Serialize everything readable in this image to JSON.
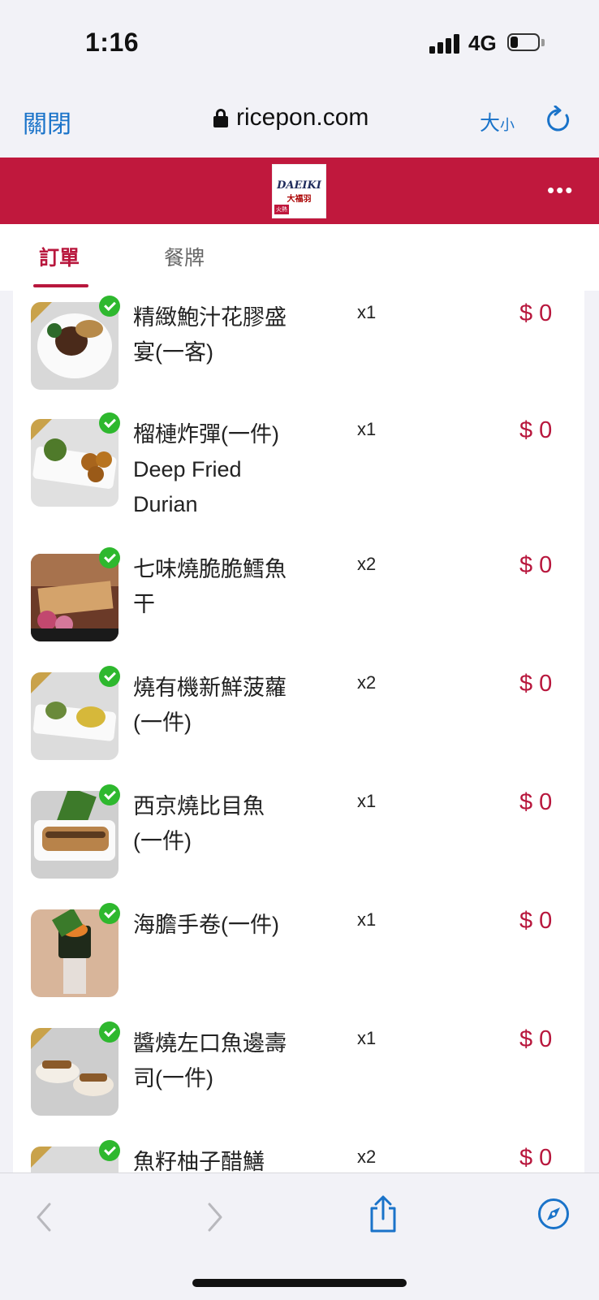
{
  "status_bar": {
    "time": "1:16",
    "network": "4G"
  },
  "browser": {
    "close_label": "關閉",
    "url": "ricepon.com",
    "text_size_big": "大",
    "text_size_small": "小"
  },
  "app": {
    "logo_text": "DAEIKI",
    "logo_subtitle": "大福羽",
    "logo_tag": "火熱",
    "brand_color": "#c0183d"
  },
  "tabs": [
    {
      "label": "訂單",
      "active": true
    },
    {
      "label": "餐牌",
      "active": false
    }
  ],
  "order_items": [
    {
      "name": "精緻鮑汁花膠盛宴(一客)",
      "qty": "x1",
      "price": "$ 0"
    },
    {
      "name": "榴槤炸彈(一件) Deep Fried Durian",
      "qty": "x1",
      "price": "$ 0"
    },
    {
      "name": "七味燒脆脆鱈魚干",
      "qty": "x2",
      "price": "$ 0"
    },
    {
      "name": "燒有機新鮮菠蘿(一件)",
      "qty": "x2",
      "price": "$ 0"
    },
    {
      "name": "西京燒比目魚(一件)",
      "qty": "x1",
      "price": "$ 0"
    },
    {
      "name": "海膽手卷(一件)",
      "qty": "x1",
      "price": "$ 0"
    },
    {
      "name": "醬燒左口魚邊壽司(一件)",
      "qty": "x1",
      "price": "$ 0"
    },
    {
      "name": "魚籽柚子醋鱔",
      "qty": "x2",
      "price": "$ 0"
    }
  ]
}
